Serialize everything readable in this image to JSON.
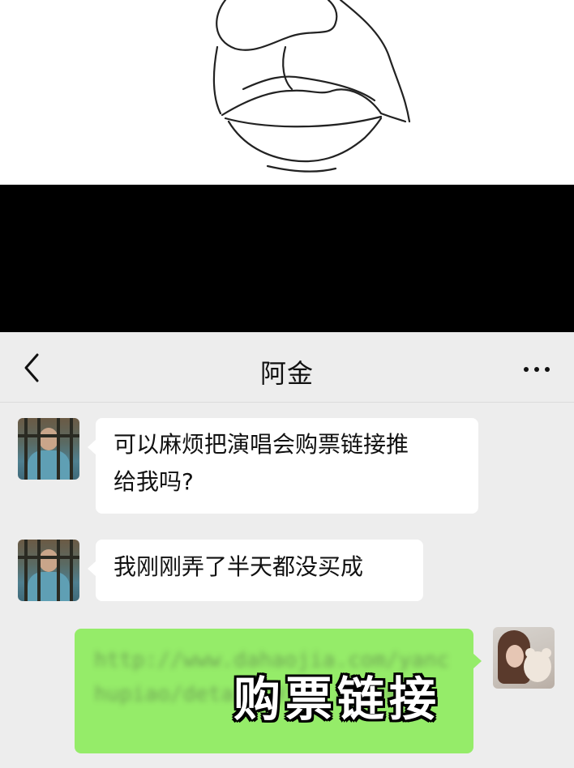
{
  "chat": {
    "title": "阿金",
    "back_icon": "chevron-left-icon",
    "more_icon": "more-dots-icon"
  },
  "messages": [
    {
      "sender": "阿金",
      "side": "left",
      "text_line1": "可以麻烦把演唱会购票链接推",
      "text_line2": "给我吗?"
    },
    {
      "sender": "阿金",
      "side": "left",
      "text": "我刚刚弄了半天都没买成"
    },
    {
      "sender": "self",
      "side": "right",
      "link_text": "http://www.dahaojia.com/yanchupiao/detail/9149 2.html",
      "overlay_caption": "购票链接"
    }
  ],
  "colors": {
    "chat_background": "#ededed",
    "incoming_bubble": "#ffffff",
    "outgoing_bubble": "#95ec69"
  }
}
